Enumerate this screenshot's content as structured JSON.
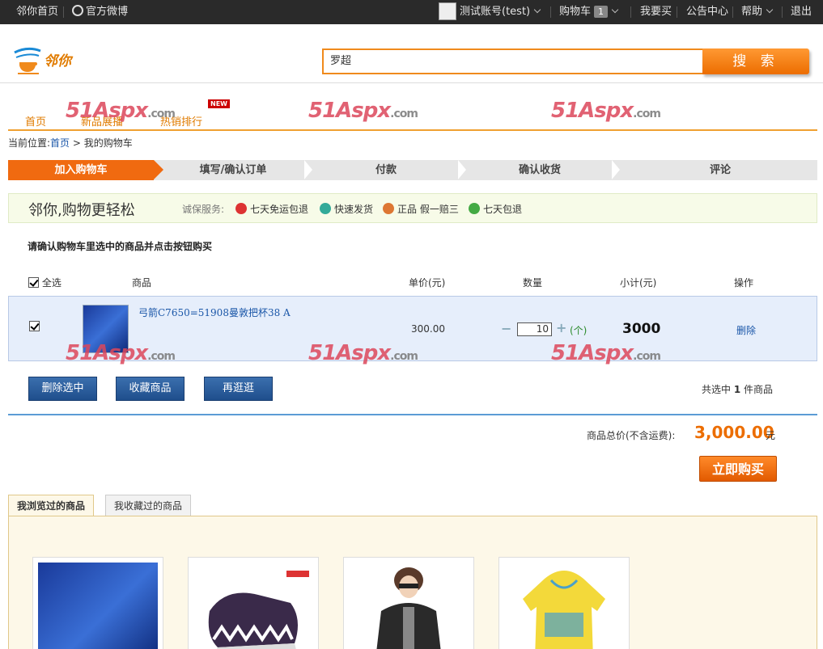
{
  "topbar": {
    "home": "邻你首页",
    "weibo": "官方微博",
    "account": "测试账号(test)",
    "cart": "购物车",
    "cart_count": "1",
    "buy": "我要买",
    "notice": "公告中心",
    "help": "帮助",
    "logout": "退出"
  },
  "header": {
    "search_value": "罗超",
    "search_button": "搜 索"
  },
  "nav": {
    "home": "首页",
    "new_products": "新品展播",
    "hot": "热销排行",
    "new_tag": "NEW"
  },
  "watermark": {
    "text": "51Aspx",
    "suffix": ".com"
  },
  "breadcrumb": {
    "label": "当前位置:",
    "home": "首页",
    "separator": " > ",
    "current": "我的购物车"
  },
  "steps": [
    "加入购物车",
    "填写/确认订单",
    "付款",
    "确认收货",
    "评论"
  ],
  "service": {
    "slogan": "邻你,购物更轻松",
    "label": "诚保服务:",
    "items": [
      "七天免运包退",
      "快速发货",
      "正品 假一赔三",
      "七天包退"
    ]
  },
  "cart": {
    "confirm_text": "请确认购物车里选中的商品并点击按钮购买",
    "headers": {
      "select_all": "全选",
      "product": "商品",
      "unit_price": "单价(元)",
      "quantity": "数量",
      "subtotal": "小计(元)",
      "action": "操作"
    },
    "items": [
      {
        "name": "弓箭C7650=51908曼敦把杯38 A",
        "price": "300.00",
        "quantity": "10",
        "unit": "(个)",
        "subtotal": "3000",
        "action": "删除"
      }
    ],
    "buttons": {
      "delete_selected": "删除选中",
      "favorite": "收藏商品",
      "continue": "再逛逛"
    },
    "selected_prefix": "共选中",
    "selected_count": "1",
    "selected_suffix": "件商品",
    "total_label": "商品总价(不含运费):",
    "total_value": "3,000.00",
    "total_unit": "元",
    "buy_now": "立即购买"
  },
  "tabs": [
    "我浏览过的商品",
    "我收藏过的商品"
  ],
  "colors": {
    "accent": "#ec6d00",
    "link": "#1a56a8",
    "button_blue": "#1f4e8c",
    "topbar": "#2a2a2a"
  }
}
